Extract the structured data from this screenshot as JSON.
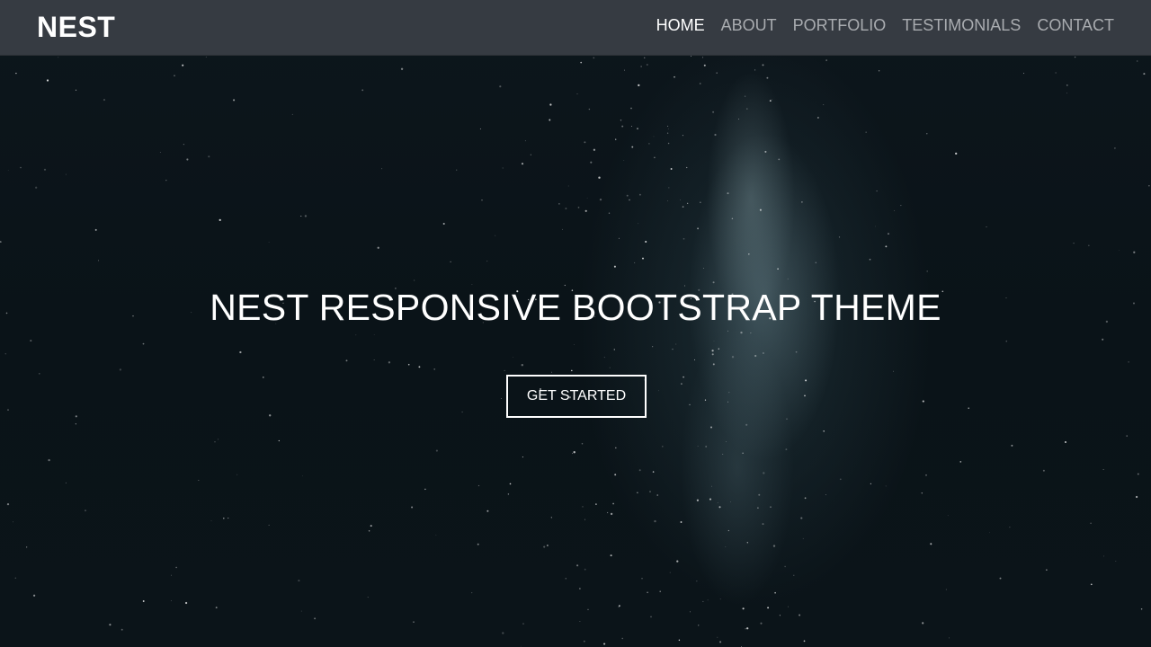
{
  "navbar": {
    "brand": "NEST",
    "links": [
      {
        "label": "HOME",
        "active": true
      },
      {
        "label": "ABOUT",
        "active": false
      },
      {
        "label": "PORTFOLIO",
        "active": false
      },
      {
        "label": "TESTIMONIALS",
        "active": false
      },
      {
        "label": "CONTACT",
        "active": false
      }
    ]
  },
  "hero": {
    "title": "NEST RESPONSIVE BOOTSTRAP THEME",
    "cta_label": "GET STARTED"
  },
  "colors": {
    "navbar_bg": "#363b42",
    "nav_link": "#a9acb0",
    "nav_link_active": "#ffffff",
    "hero_bg": "#0b1318"
  }
}
